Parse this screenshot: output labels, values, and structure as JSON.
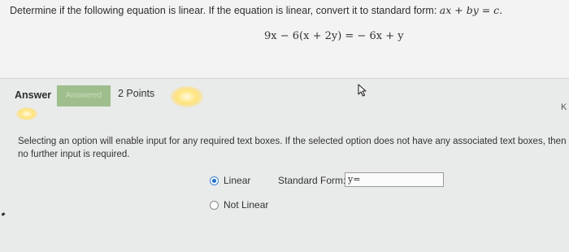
{
  "question": {
    "prompt_text": "Determine if the following equation is linear. If the equation is linear, convert it to standard form: ",
    "prompt_math": "ax + by = c.",
    "equation": "9x − 6(x + 2y) = − 6x + y"
  },
  "answer_bar": {
    "label": "Answer",
    "badge": "Answered",
    "points": "2 Points",
    "edge_letter": "K"
  },
  "instructions": "Selecting an option will enable input for any required text boxes. If the selected option does not have any associated text boxes, then no further input is required.",
  "options": {
    "linear": {
      "label": "Linear",
      "selected": true
    },
    "not_linear": {
      "label": "Not Linear",
      "selected": false
    }
  },
  "standard_form": {
    "label": "Standard Form:",
    "value": "y="
  },
  "colors": {
    "radio_accent": "#1f6fc5",
    "answered_badge": "#9fbe8d"
  },
  "icons": {
    "cursor": "mouse-pointer-icon"
  }
}
